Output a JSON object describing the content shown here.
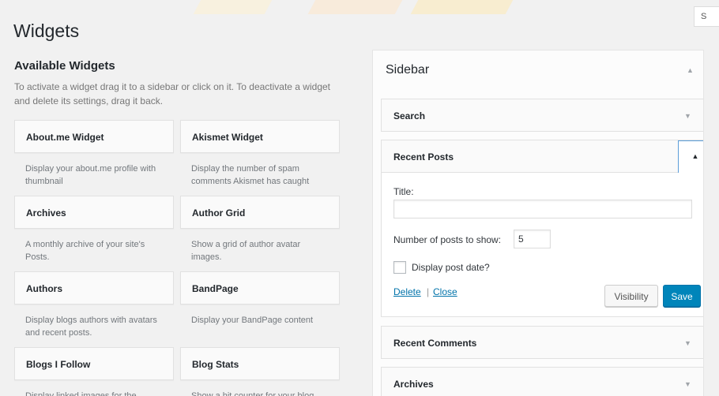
{
  "screen_options": {
    "label": "S"
  },
  "page": {
    "title": "Widgets"
  },
  "available": {
    "title": "Available Widgets",
    "description": "To activate a widget drag it to a sidebar or click on it. To deactivate a widget and delete its settings, drag it back."
  },
  "widgets": [
    {
      "title": "About.me Widget",
      "description": "Display your about.me profile with thumbnail"
    },
    {
      "title": "Akismet Widget",
      "description": "Display the number of spam comments Akismet has caught"
    },
    {
      "title": "Archives",
      "description": "A monthly archive of your site's Posts."
    },
    {
      "title": "Author Grid",
      "description": "Show a grid of author avatar images."
    },
    {
      "title": "Authors",
      "description": "Display blogs authors with avatars and recent posts."
    },
    {
      "title": "BandPage",
      "description": "Display your BandPage content"
    },
    {
      "title": "Blogs I Follow",
      "description": "Display linked images for the"
    },
    {
      "title": "Blog Stats",
      "description": "Show a hit counter for your blog"
    }
  ],
  "sidebar": {
    "title": "Sidebar",
    "widgets": {
      "search": "Search",
      "recent_posts": "Recent Posts",
      "recent_comments": "Recent Comments",
      "archives": "Archives"
    },
    "recent_posts_form": {
      "title_label": "Title:",
      "title_value": "",
      "number_label": "Number of posts to show:",
      "number_value": "5",
      "display_date_label": "Display post date?",
      "display_date_checked": false,
      "delete_label": "Delete",
      "separator": "|",
      "close_label": "Close",
      "visibility_label": "Visibility",
      "save_label": "Save"
    }
  },
  "icons": {
    "arrow_up": "▲",
    "arrow_down": "▼"
  },
  "colors": {
    "background": "#f1f1f1",
    "accent": "#0085ba",
    "link": "#0073aa",
    "stripe_yellow": "#fde9a6",
    "stripe_orange": "#fbd0a0"
  }
}
